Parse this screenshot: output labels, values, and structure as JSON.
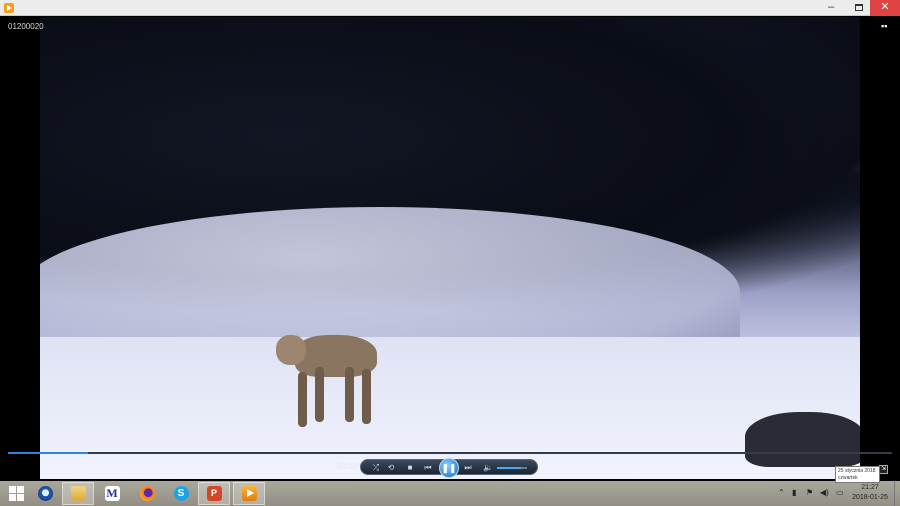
{
  "window": {
    "min": "–",
    "max": "",
    "close": "✕"
  },
  "player": {
    "clip_title": "01200020",
    "current_time": "00:02",
    "progress": 0.09,
    "volume": 0.8,
    "controls": {
      "shuffle": "⤮",
      "repeat": "⟲",
      "stop": "■",
      "prev": "⏮",
      "play_pause": "❚❚",
      "next": "⏭",
      "volume": "🔈"
    }
  },
  "tooltip": {
    "line1": "25 stycznia 2018",
    "line2": "czwartek"
  },
  "taskbar": {
    "apps": [
      {
        "name": "thunderbird-icon"
      },
      {
        "name": "file-explorer-icon"
      },
      {
        "name": "m-app-icon",
        "label": "M"
      },
      {
        "name": "firefox-icon"
      },
      {
        "name": "skype-icon",
        "label": "S"
      },
      {
        "name": "powerpoint-icon",
        "label": "P"
      },
      {
        "name": "media-player-icon"
      }
    ],
    "tray": {
      "chevron": "⌃",
      "network": "▮",
      "flag": "⚑",
      "volume": "◀)",
      "keyboard": "▭"
    },
    "clock": {
      "time": "21:27",
      "date": "2018-01-25"
    }
  }
}
